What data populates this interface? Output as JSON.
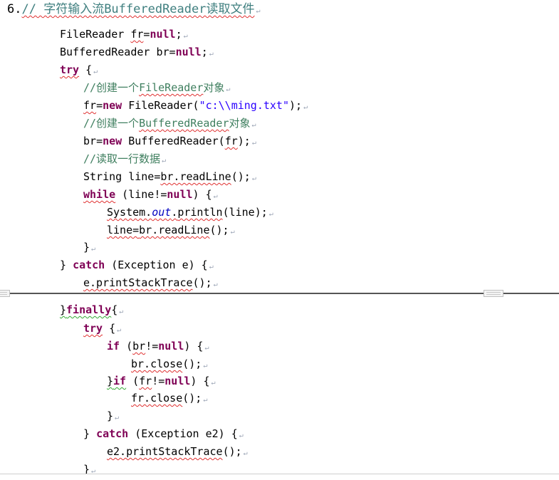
{
  "heading": {
    "number": "6.",
    "text": "// 字符输入流BufferedReader读取文件"
  },
  "lines": {
    "l1": {
      "a": "FileReader ",
      "b": "fr",
      "c": "=",
      "d": "null",
      "e": ";"
    },
    "l2": {
      "a": "BufferedReader ",
      "b": "br",
      "c": "=",
      "d": "null",
      "e": ";"
    },
    "l3": {
      "a": "try",
      "b": " {"
    },
    "l4": {
      "a": "//创建一个",
      "b": "FileReader",
      "c": "对象"
    },
    "l5": {
      "a": "fr",
      "b": "=",
      "c": "new",
      "d": " FileReader(",
      "e": "\"c:\\\\ming.txt\"",
      "f": ");"
    },
    "l6": {
      "a": "//创建一个",
      "b": "BufferedReader",
      "c": "对象"
    },
    "l7": {
      "a": "br",
      "b": "=",
      "c": "new",
      "d": " BufferedReader(",
      "e": "fr",
      "f": ");"
    },
    "l8": {
      "a": "//读取一行数据"
    },
    "l9": {
      "a": "String line=",
      "b": "br.readLine",
      "c": "();"
    },
    "l10": {
      "a": "while",
      "b": " (line!=",
      "c": "null",
      "d": ") {"
    },
    "l11": {
      "a": "System.",
      "b": "out",
      "c": ".",
      "d": "println",
      "e": "(line);"
    },
    "l12": {
      "a": "line=",
      "b": "br.readLine",
      "c": "();"
    },
    "l13": {
      "a": "}"
    },
    "l14": {
      "a": "} ",
      "b": "catch",
      "c": " (Exception e) {"
    },
    "l15": {
      "a": "e.printStackTrace",
      "b": "();"
    },
    "l16": {
      "a": "}",
      "b": "finally",
      "c": "{"
    },
    "l17": {
      "a": "try",
      "b": " {"
    },
    "l18": {
      "a": "if",
      "b": " (",
      "c": "br",
      "d": "!=",
      "e": "null",
      "f": ") {"
    },
    "l19": {
      "a": "br.close",
      "b": "();"
    },
    "l20": {
      "a": "}",
      "b": "if",
      "c": " (",
      "d": "fr",
      "e": "!=",
      "f": "null",
      "g": ") {"
    },
    "l21": {
      "a": "fr.close",
      "b": "();"
    },
    "l22": {
      "a": "}"
    },
    "l23": {
      "a": "} ",
      "b": "catch",
      "c": " (Exception e2) {"
    },
    "l24": {
      "a": "e2.printStackTrace",
      "b": "();"
    },
    "l25": {
      "a": "}"
    }
  },
  "paragraph_mark": "↵",
  "colors": {
    "keyword": "#7f0055",
    "comment": "#3f7f5f",
    "string": "#2a00ff",
    "static_field": "#0000c0",
    "spell_squiggle": "#e03030",
    "grammar_squiggle": "#33aa33"
  },
  "icons": {
    "paragraph_mark": "paragraph-mark-icon",
    "page_break_marker": "page-break-marker-icon"
  }
}
